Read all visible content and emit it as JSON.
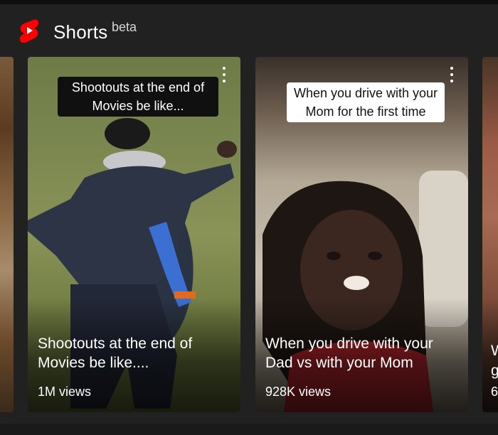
{
  "header": {
    "title": "Shorts",
    "badge": "beta",
    "logo_color": "#ff0000"
  },
  "shorts": [
    {
      "overlay_caption": "Shootouts at the end of Movies be like...",
      "title": "Shootouts at the end of Movies be like....",
      "views": "1M views"
    },
    {
      "overlay_caption": "When you drive with your Mom for the first time",
      "title": "When you drive with your Dad vs with your Mom",
      "views": "928K views"
    }
  ],
  "partial_card": {
    "title_fragment_1": "W",
    "title_fragment_2": "g",
    "views_fragment": "6"
  },
  "icons": {
    "logo": "youtube-shorts-icon",
    "menu": "more-vert-icon"
  }
}
